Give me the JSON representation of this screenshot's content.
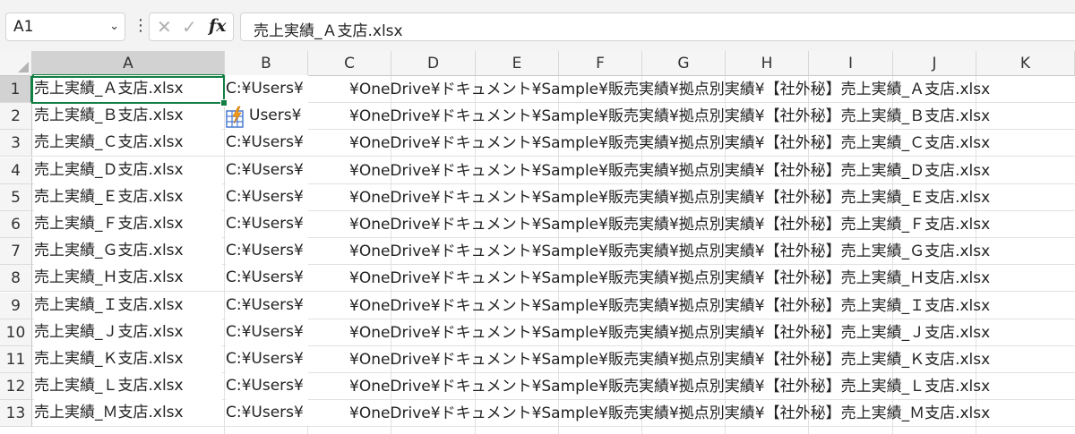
{
  "name_box": {
    "value": "A1",
    "dropdown_icon": "chevron-down-icon"
  },
  "formula_bar": {
    "more_icon": "vertical-ellipsis-icon",
    "cancel_icon": "✕",
    "enter_icon": "✓",
    "fx_label": "fx",
    "content": "売上実績_Ａ支店.xlsx"
  },
  "columns": [
    "A",
    "B",
    "C",
    "D",
    "E",
    "F",
    "G",
    "H",
    "I",
    "J",
    "K"
  ],
  "selected_column": "A",
  "selected_row": "1",
  "rows": [
    {
      "num": "1",
      "a": "売上実績_Ａ支店.xlsx",
      "b": "C:¥Users¥",
      "c": "¥OneDrive¥ドキュメント¥Sample¥販売実績¥拠点別実績¥【社外秘】売上実績_Ａ支店.xlsx"
    },
    {
      "num": "2",
      "a": "売上実績_Ｂ支店.xlsx",
      "b": "Users¥",
      "c": "¥OneDrive¥ドキュメント¥Sample¥販売実績¥拠点別実績¥【社外秘】売上実績_Ｂ支店.xlsx"
    },
    {
      "num": "3",
      "a": "売上実績_Ｃ支店.xlsx",
      "b": "C:¥Users¥",
      "c": "¥OneDrive¥ドキュメント¥Sample¥販売実績¥拠点別実績¥【社外秘】売上実績_Ｃ支店.xlsx"
    },
    {
      "num": "4",
      "a": "売上実績_Ｄ支店.xlsx",
      "b": "C:¥Users¥",
      "c": "¥OneDrive¥ドキュメント¥Sample¥販売実績¥拠点別実績¥【社外秘】売上実績_Ｄ支店.xlsx"
    },
    {
      "num": "5",
      "a": "売上実績_Ｅ支店.xlsx",
      "b": "C:¥Users¥",
      "c": "¥OneDrive¥ドキュメント¥Sample¥販売実績¥拠点別実績¥【社外秘】売上実績_Ｅ支店.xlsx"
    },
    {
      "num": "6",
      "a": "売上実績_Ｆ支店.xlsx",
      "b": "C:¥Users¥",
      "c": "¥OneDrive¥ドキュメント¥Sample¥販売実績¥拠点別実績¥【社外秘】売上実績_Ｆ支店.xlsx"
    },
    {
      "num": "7",
      "a": "売上実績_Ｇ支店.xlsx",
      "b": "C:¥Users¥",
      "c": "¥OneDrive¥ドキュメント¥Sample¥販売実績¥拠点別実績¥【社外秘】売上実績_Ｇ支店.xlsx"
    },
    {
      "num": "8",
      "a": "売上実績_Ｈ支店.xlsx",
      "b": "C:¥Users¥",
      "c": "¥OneDrive¥ドキュメント¥Sample¥販売実績¥拠点別実績¥【社外秘】売上実績_Ｈ支店.xlsx"
    },
    {
      "num": "9",
      "a": "売上実績_Ｉ支店.xlsx",
      "b": "C:¥Users¥",
      "c": "¥OneDrive¥ドキュメント¥Sample¥販売実績¥拠点別実績¥【社外秘】売上実績_Ｉ支店.xlsx"
    },
    {
      "num": "10",
      "a": "売上実績_Ｊ支店.xlsx",
      "b": "C:¥Users¥",
      "c": "¥OneDrive¥ドキュメント¥Sample¥販売実績¥拠点別実績¥【社外秘】売上実績_Ｊ支店.xlsx"
    },
    {
      "num": "11",
      "a": "売上実績_Ｋ支店.xlsx",
      "b": "C:¥Users¥",
      "c": "¥OneDrive¥ドキュメント¥Sample¥販売実績¥拠点別実績¥【社外秘】売上実績_Ｋ支店.xlsx"
    },
    {
      "num": "12",
      "a": "売上実績_Ｌ支店.xlsx",
      "b": "C:¥Users¥",
      "c": "¥OneDrive¥ドキュメント¥Sample¥販売実績¥拠点別実績¥【社外秘】売上実績_Ｌ支店.xlsx"
    },
    {
      "num": "13",
      "a": "売上実績_Ｍ支店.xlsx",
      "b": "C:¥Users¥",
      "c": "¥OneDrive¥ドキュメント¥Sample¥販売実績¥拠点別実績¥【社外秘】売上実績_Ｍ支店.xlsx"
    }
  ],
  "flash_fill_icon": "flash-fill-icon",
  "colors": {
    "selection": "#137e43",
    "header_bg": "#f5f5f5",
    "header_selected_bg": "#d2d2d2"
  }
}
